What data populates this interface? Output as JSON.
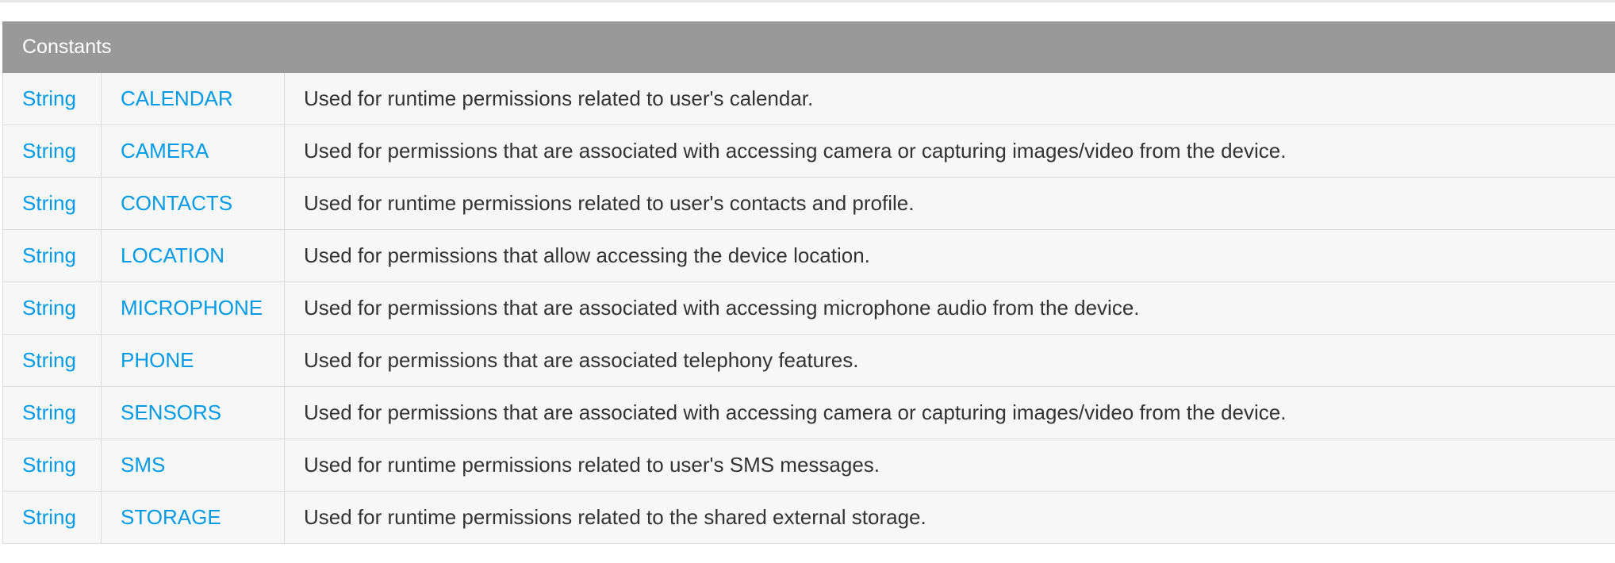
{
  "table": {
    "header": "Constants",
    "rows": [
      {
        "type": "String",
        "name": "CALENDAR",
        "description": "Used for runtime permissions related to user's calendar."
      },
      {
        "type": "String",
        "name": "CAMERA",
        "description": "Used for permissions that are associated with accessing camera or capturing images/video from the device."
      },
      {
        "type": "String",
        "name": "CONTACTS",
        "description": "Used for runtime permissions related to user's contacts and profile."
      },
      {
        "type": "String",
        "name": "LOCATION",
        "description": "Used for permissions that allow accessing the device location."
      },
      {
        "type": "String",
        "name": "MICROPHONE",
        "description": "Used for permissions that are associated with accessing microphone audio from the device."
      },
      {
        "type": "String",
        "name": "PHONE",
        "description": "Used for permissions that are associated telephony features."
      },
      {
        "type": "String",
        "name": "SENSORS",
        "description": "Used for permissions that are associated with accessing camera or capturing images/video from the device."
      },
      {
        "type": "String",
        "name": "SMS",
        "description": "Used for runtime permissions related to user's SMS messages."
      },
      {
        "type": "String",
        "name": "STORAGE",
        "description": "Used for runtime permissions related to the shared external storage."
      }
    ]
  },
  "colors": {
    "header_bg": "#999999",
    "link": "#039be5",
    "text": "#333333",
    "row_bg": "#f7f7f7",
    "border": "#dcdcdc"
  }
}
